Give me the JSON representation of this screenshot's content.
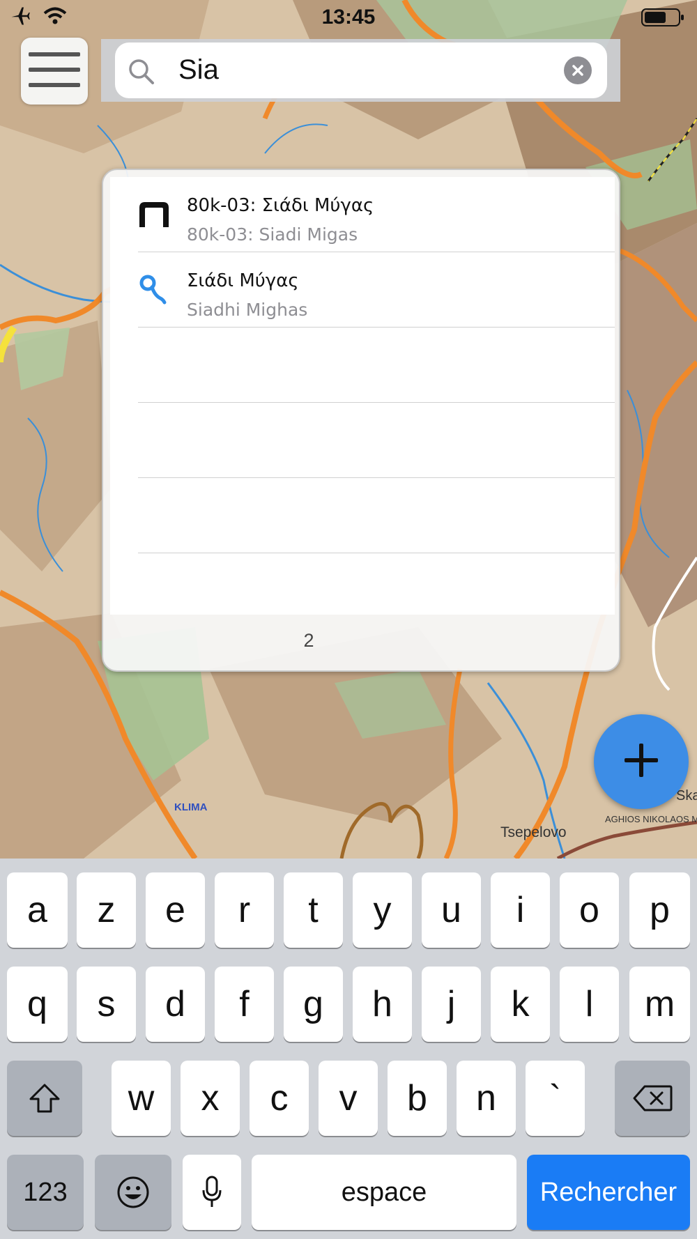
{
  "status_bar": {
    "time": "13:45"
  },
  "search": {
    "value": "Sia"
  },
  "results": {
    "items": [
      {
        "title": "80k-03: Σιάδι Μύγας",
        "subtitle": "80k-03: Siadi Migas",
        "icon": "arch-icon"
      },
      {
        "title": "Σιάδι Μύγας",
        "subtitle": "Siadhi Mighas",
        "icon": "pin-icon"
      }
    ],
    "count": "2"
  },
  "map_labels": {
    "klima": "KLIMA",
    "tsepelovo": "Tsepelovo",
    "aghios": "AGHIOS NIKOLAOS M",
    "ska": "Ska"
  },
  "keyboard": {
    "row1": [
      "a",
      "z",
      "e",
      "r",
      "t",
      "y",
      "u",
      "i",
      "o",
      "p"
    ],
    "row2": [
      "q",
      "s",
      "d",
      "f",
      "g",
      "h",
      "j",
      "k",
      "l",
      "m"
    ],
    "row3": [
      "w",
      "x",
      "c",
      "v",
      "b",
      "n",
      "`"
    ],
    "numbers_label": "123",
    "space_label": "espace",
    "search_label": "Rechercher"
  },
  "colors": {
    "accent": "#1a7cf5",
    "fab": "#3d8de6",
    "trail": "#f0892a"
  }
}
